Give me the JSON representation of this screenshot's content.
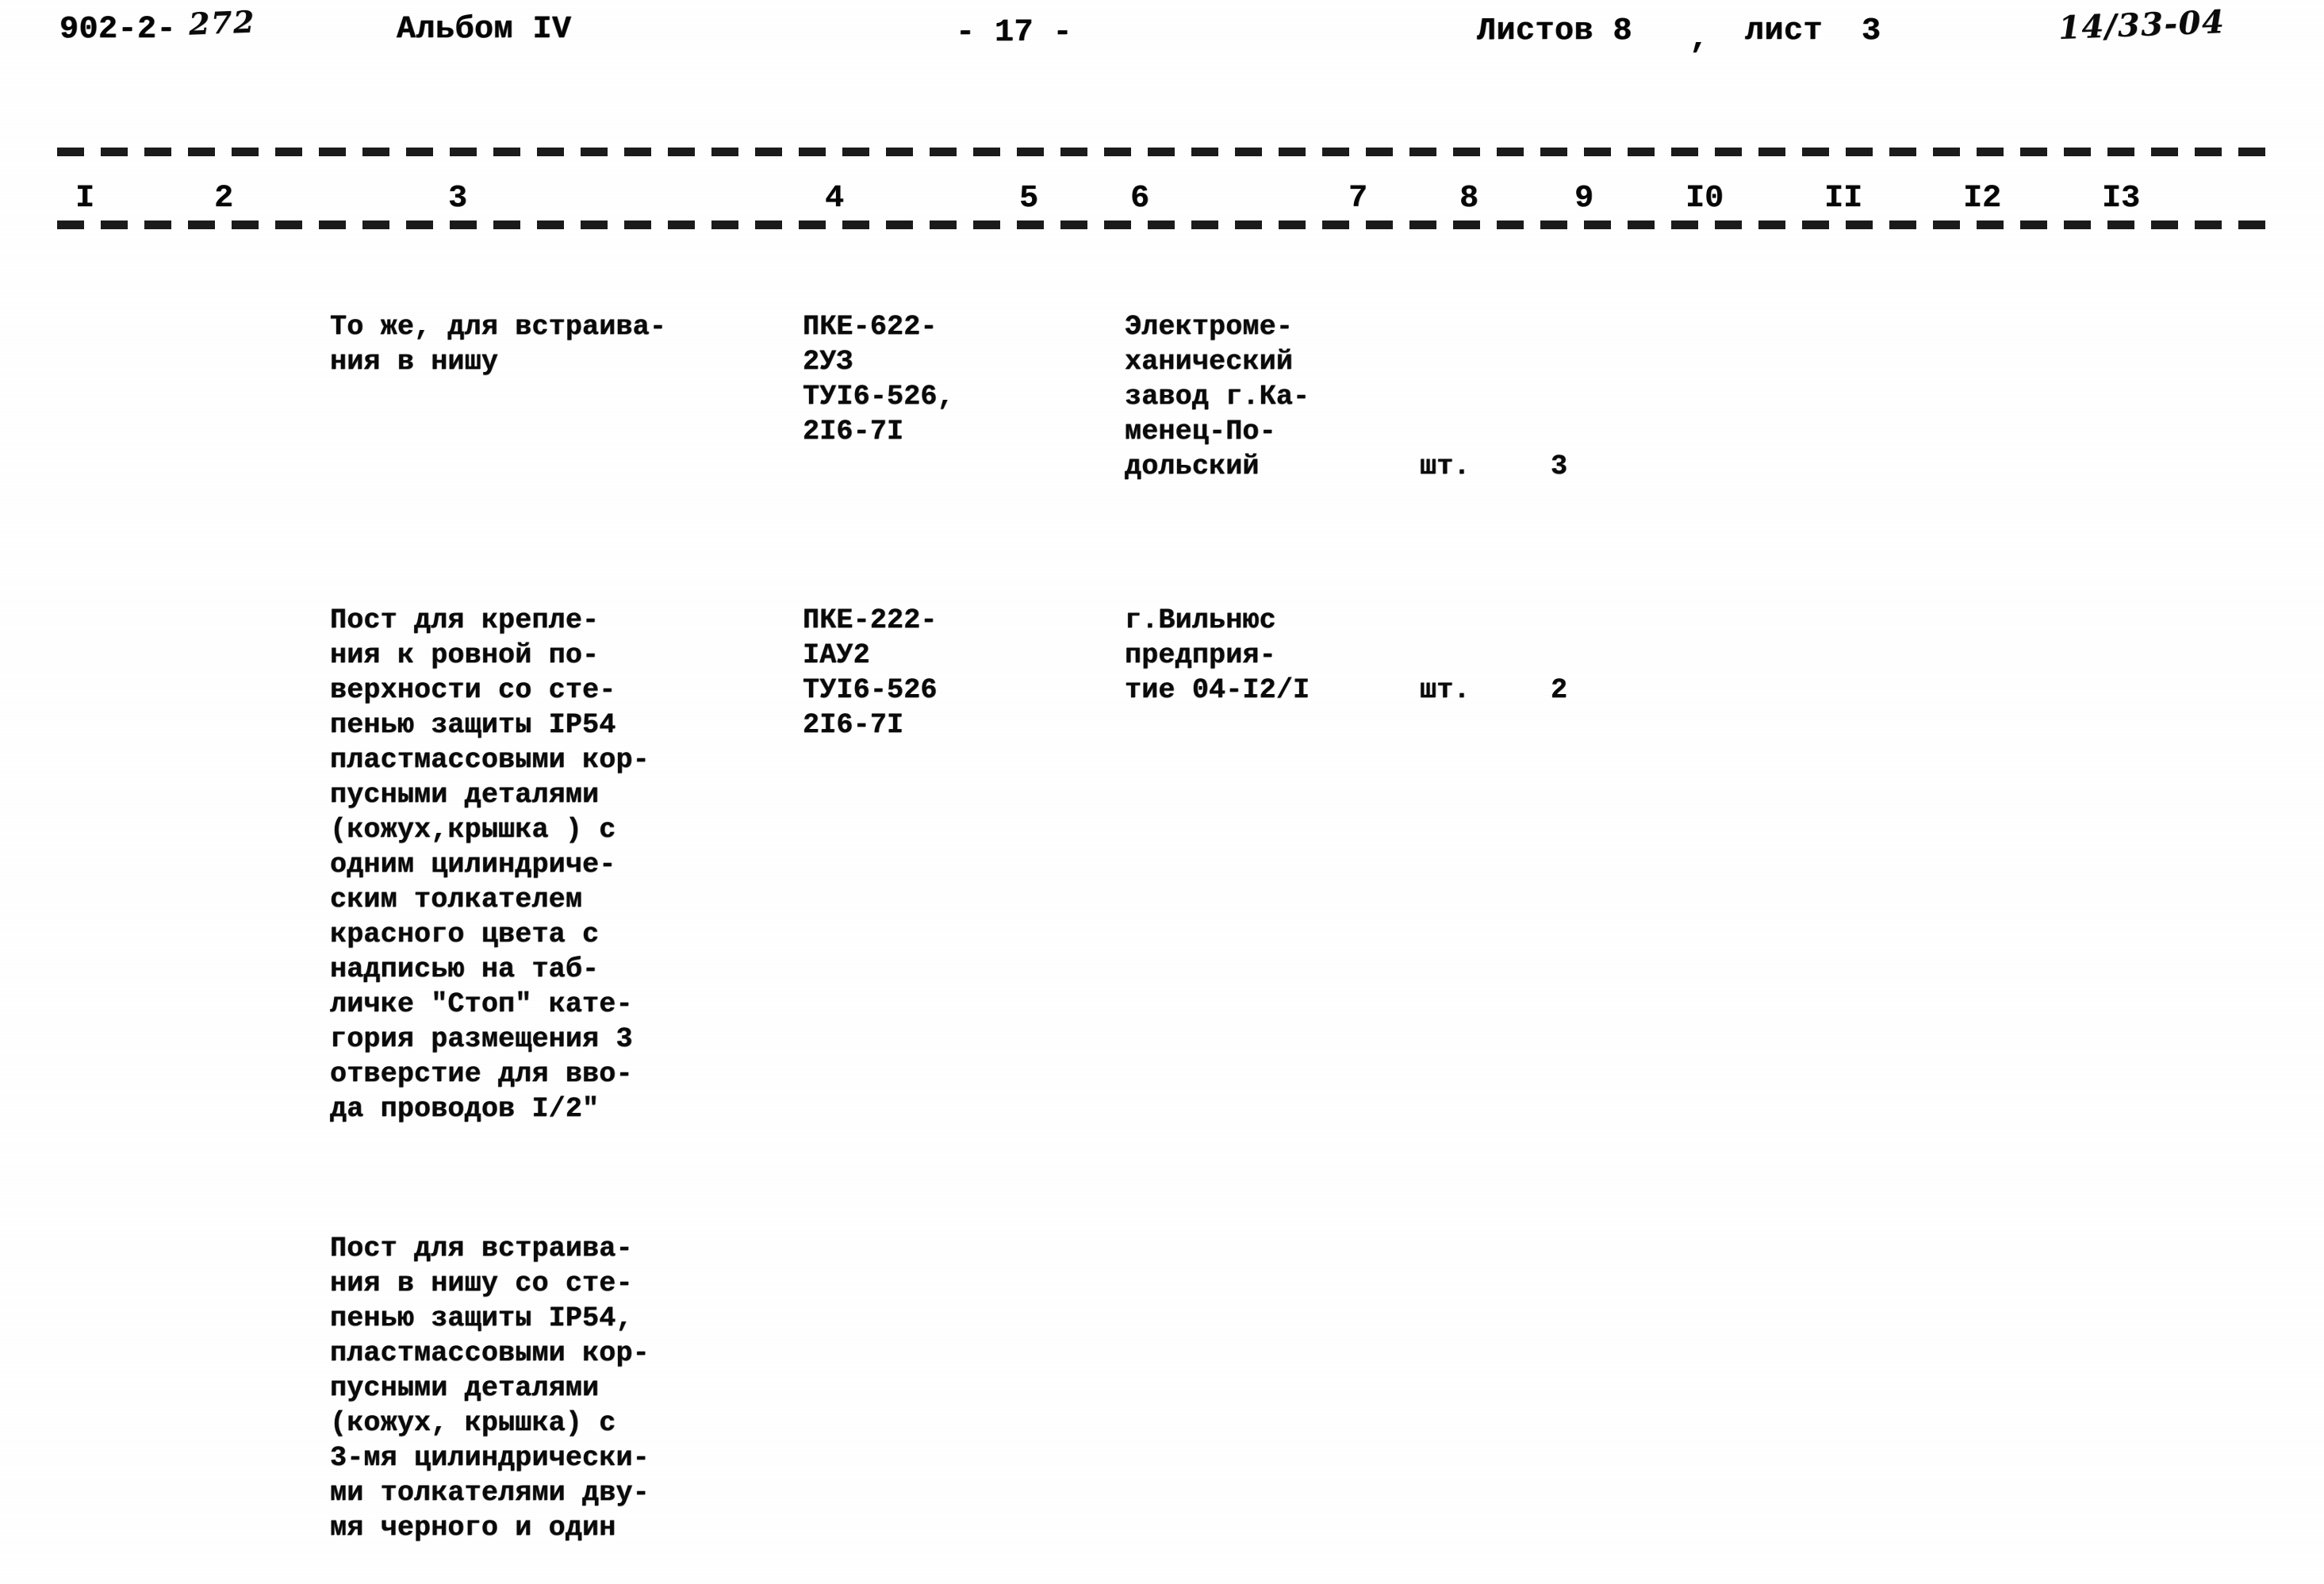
{
  "header": {
    "doc_code": "902-2-",
    "doc_code_handwritten": "272",
    "album": "Альбом IV",
    "page_number": "- 17 -",
    "sheets_total": "Листов 8",
    "sheet_separator": ",",
    "sheet_current": "лист  3",
    "drawing_handwritten": "14/33-04"
  },
  "table": {
    "column_numbers": [
      "I",
      "2",
      "3",
      "4",
      "5",
      "6",
      "7",
      "8",
      "9",
      "I0",
      "II",
      "I2",
      "I3"
    ],
    "rows": [
      {
        "description": "То же, для встраива-\nния в нишу",
        "type_designation": "ПКЕ-622-\n2УЗ\nТУI6-526,\n2I6-7I",
        "manufacturer": "Электроме-\nханический\nзавод г.Ка-\nменец-По-\nдольский",
        "unit": "шт.",
        "quantity": "3"
      },
      {
        "description": "Пост для крепле-\nния к ровной по-\nверхности со сте-\nпенью защиты IP54\nпластмассовыми кор-\nпусными деталями\n(кожух,крышка ) с\nодним цилиндриче-\nским толкателем\nкрасного цвета с\nнадписью на таб-\nличке \"Стоп\" кате-\nгория размещения 3\nотверстие для вво-\nда проводов I/2\"",
        "type_designation": "ПКЕ-222-\nIАУ2\nТУI6-526\n2I6-7I",
        "manufacturer": "г.Вильнюс\nпредприя-\nтие 04-I2/I",
        "unit": "шт.",
        "quantity": "2"
      },
      {
        "description": "Пост для встраива-\nния в нишу со сте-\nпенью защиты IP54,\nпластмассовыми кор-\nпусными деталями\n(кожух, крышка) с\n3-мя цилиндрически-\nми толкателями дву-\nмя черного и один",
        "type_designation": "",
        "manufacturer": "",
        "unit": "",
        "quantity": ""
      }
    ]
  },
  "colors": {
    "ink": "#0a0a0a",
    "paper": "#ffffff"
  }
}
